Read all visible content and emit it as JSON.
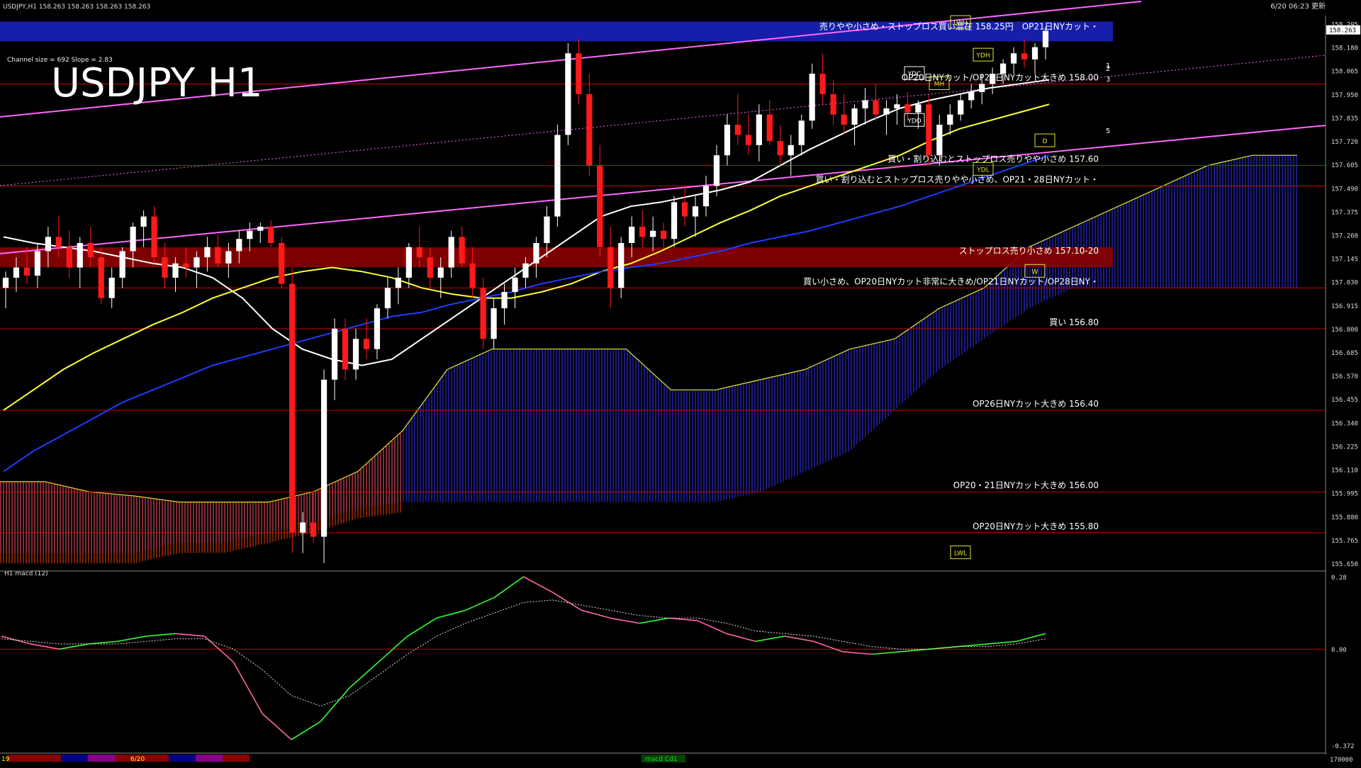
{
  "header": {
    "symbol_info": "USDJPY,H1  158.263 158.263 158.263 158.263",
    "datetime": "6/20 06:23 更新",
    "big_title": "USDJPY H1",
    "channel_info": "Channel size = 692 Slope = 2.83"
  },
  "colors": {
    "background": "#000000",
    "bull_candle": "#ffffff",
    "bear_candle": "#ff1a1a",
    "ema_fast": "#ffffff",
    "ema_slow": "#ffff33",
    "ema_long": "#1f3cff",
    "bollinger": "#cc0000",
    "chikou": "#33cc33",
    "channel": "#ff66ff",
    "kumo_bull": "#2a2ae0",
    "kumo_bear": "#ff4400",
    "level_line": "#cc0000",
    "macd_up": "#33ff33",
    "macd_down": "#ff66aa"
  },
  "chart_data": {
    "type": "candlestick",
    "title": "USDJPY H1",
    "ylim": [
      155.65,
      158.335
    ],
    "y_ticks": [
      "158.295",
      "158.180",
      "158.065",
      "157.950",
      "157.835",
      "157.720",
      "157.605",
      "157.490",
      "157.375",
      "157.260",
      "157.145",
      "157.030",
      "156.915",
      "156.800",
      "156.685",
      "156.570",
      "156.455",
      "156.340",
      "156.225",
      "156.110",
      "155.995",
      "155.880",
      "155.765",
      "155.650"
    ],
    "current_price": "158.263",
    "candles_ohlc": [
      [
        157.0,
        157.08,
        156.9,
        157.05
      ],
      [
        157.05,
        157.15,
        156.98,
        157.1
      ],
      [
        157.1,
        157.2,
        157.02,
        157.06
      ],
      [
        157.06,
        157.22,
        157.0,
        157.18
      ],
      [
        157.18,
        157.3,
        157.1,
        157.25
      ],
      [
        157.25,
        157.35,
        157.15,
        157.2
      ],
      [
        157.2,
        157.28,
        157.05,
        157.1
      ],
      [
        157.1,
        157.25,
        157.0,
        157.22
      ],
      [
        157.22,
        157.3,
        157.1,
        157.15
      ],
      [
        157.15,
        157.2,
        156.92,
        156.95
      ],
      [
        156.95,
        157.1,
        156.9,
        157.05
      ],
      [
        157.05,
        157.2,
        157.0,
        157.18
      ],
      [
        157.18,
        157.32,
        157.1,
        157.3
      ],
      [
        157.3,
        157.38,
        157.2,
        157.35
      ],
      [
        157.35,
        157.4,
        157.12,
        157.15
      ],
      [
        157.15,
        157.22,
        157.0,
        157.05
      ],
      [
        157.05,
        157.15,
        156.98,
        157.12
      ],
      [
        157.12,
        157.2,
        157.05,
        157.1
      ],
      [
        157.1,
        157.18,
        157.0,
        157.15
      ],
      [
        157.15,
        157.25,
        157.08,
        157.2
      ],
      [
        157.2,
        157.26,
        157.1,
        157.12
      ],
      [
        157.12,
        157.22,
        157.05,
        157.18
      ],
      [
        157.18,
        157.28,
        157.12,
        157.24
      ],
      [
        157.24,
        157.32,
        157.18,
        157.28
      ],
      [
        157.28,
        157.32,
        157.22,
        157.3
      ],
      [
        157.3,
        157.33,
        157.2,
        157.22
      ],
      [
        157.22,
        157.25,
        157.0,
        157.02
      ],
      [
        157.02,
        157.1,
        155.7,
        155.8
      ],
      [
        155.8,
        155.9,
        155.7,
        155.85
      ],
      [
        155.85,
        156.0,
        155.75,
        155.78
      ],
      [
        155.78,
        156.6,
        155.65,
        156.55
      ],
      [
        156.55,
        156.85,
        156.45,
        156.8
      ],
      [
        156.8,
        156.85,
        156.55,
        156.6
      ],
      [
        156.6,
        156.8,
        156.55,
        156.75
      ],
      [
        156.75,
        156.85,
        156.65,
        156.7
      ],
      [
        156.7,
        156.92,
        156.65,
        156.9
      ],
      [
        156.9,
        157.05,
        156.85,
        157.0
      ],
      [
        157.0,
        157.1,
        156.92,
        157.05
      ],
      [
        157.05,
        157.22,
        157.0,
        157.2
      ],
      [
        157.2,
        157.3,
        157.1,
        157.15
      ],
      [
        157.15,
        157.2,
        157.0,
        157.05
      ],
      [
        157.05,
        157.15,
        156.95,
        157.1
      ],
      [
        157.1,
        157.28,
        157.05,
        157.25
      ],
      [
        157.25,
        157.3,
        157.1,
        157.12
      ],
      [
        157.12,
        157.2,
        156.95,
        157.0
      ],
      [
        157.0,
        157.05,
        156.7,
        156.75
      ],
      [
        156.75,
        156.95,
        156.7,
        156.9
      ],
      [
        156.9,
        157.02,
        156.82,
        156.98
      ],
      [
        156.98,
        157.1,
        156.9,
        157.05
      ],
      [
        157.05,
        157.15,
        157.0,
        157.12
      ],
      [
        157.12,
        157.25,
        157.05,
        157.22
      ],
      [
        157.22,
        157.4,
        157.15,
        157.35
      ],
      [
        157.35,
        157.8,
        157.3,
        157.75
      ],
      [
        157.75,
        158.2,
        157.7,
        158.15
      ],
      [
        158.15,
        158.22,
        157.9,
        157.95
      ],
      [
        157.95,
        158.05,
        157.55,
        157.6
      ],
      [
        157.6,
        157.7,
        157.15,
        157.2
      ],
      [
        157.2,
        157.3,
        156.9,
        157.0
      ],
      [
        157.0,
        157.25,
        156.95,
        157.22
      ],
      [
        157.22,
        157.35,
        157.15,
        157.3
      ],
      [
        157.3,
        157.38,
        157.2,
        157.25
      ],
      [
        157.25,
        157.35,
        157.18,
        157.28
      ],
      [
        157.28,
        157.32,
        157.2,
        157.24
      ],
      [
        157.24,
        157.45,
        157.2,
        157.42
      ],
      [
        157.42,
        157.5,
        157.3,
        157.35
      ],
      [
        157.35,
        157.45,
        157.25,
        157.4
      ],
      [
        157.4,
        157.55,
        157.35,
        157.5
      ],
      [
        157.5,
        157.7,
        157.45,
        157.65
      ],
      [
        157.65,
        157.85,
        157.6,
        157.8
      ],
      [
        157.8,
        157.95,
        157.7,
        157.75
      ],
      [
        157.75,
        157.85,
        157.65,
        157.7
      ],
      [
        157.7,
        157.9,
        157.62,
        157.85
      ],
      [
        157.85,
        157.92,
        157.7,
        157.72
      ],
      [
        157.72,
        157.8,
        157.6,
        157.65
      ],
      [
        157.65,
        157.75,
        157.55,
        157.7
      ],
      [
        157.7,
        157.85,
        157.65,
        157.82
      ],
      [
        157.82,
        158.1,
        157.78,
        158.05
      ],
      [
        158.05,
        158.15,
        157.9,
        157.95
      ],
      [
        157.95,
        158.02,
        157.8,
        157.85
      ],
      [
        157.85,
        157.95,
        157.75,
        157.8
      ],
      [
        157.8,
        157.9,
        157.7,
        157.88
      ],
      [
        157.88,
        157.98,
        157.8,
        157.92
      ],
      [
        157.92,
        158.0,
        157.82,
        157.85
      ],
      [
        157.85,
        157.92,
        157.75,
        157.88
      ],
      [
        157.88,
        157.95,
        157.8,
        157.9
      ],
      [
        157.9,
        157.96,
        157.82,
        157.86
      ],
      [
        157.86,
        157.92,
        157.78,
        157.9
      ],
      [
        157.9,
        157.95,
        157.6,
        157.65
      ],
      [
        157.65,
        157.85,
        157.6,
        157.8
      ],
      [
        157.8,
        157.9,
        157.75,
        157.85
      ],
      [
        157.85,
        157.95,
        157.82,
        157.92
      ],
      [
        157.92,
        158.0,
        157.88,
        157.96
      ],
      [
        157.96,
        158.05,
        157.9,
        158.0
      ],
      [
        158.0,
        158.08,
        157.95,
        158.05
      ],
      [
        158.05,
        158.12,
        158.0,
        158.1
      ],
      [
        158.1,
        158.18,
        158.05,
        158.15
      ],
      [
        158.15,
        158.22,
        158.08,
        158.12
      ],
      [
        158.12,
        158.2,
        158.05,
        158.18
      ],
      [
        158.18,
        158.28,
        158.12,
        158.26
      ]
    ],
    "series": [
      {
        "name": "",
        "values": [
          157.25,
          157.22,
          157.2,
          157.18,
          157.15,
          157.12,
          157.1,
          157.05,
          156.95,
          156.8,
          156.7,
          156.65,
          156.62,
          156.65,
          156.75,
          156.85,
          156.95,
          157.05,
          157.15,
          157.25,
          157.35,
          157.4,
          157.42,
          157.45,
          157.48,
          157.52,
          157.6,
          157.68,
          157.75,
          157.82,
          157.88,
          157.92,
          157.95,
          157.98,
          158.0,
          158.02
        ]
      },
      {
        "name": "",
        "values": [
          156.4,
          156.5,
          156.6,
          156.68,
          156.75,
          156.82,
          156.88,
          156.95,
          157.0,
          157.05,
          157.08,
          157.1,
          157.08,
          157.05,
          157.0,
          156.97,
          156.95,
          156.95,
          156.98,
          157.02,
          157.08,
          157.12,
          157.18,
          157.25,
          157.32,
          157.38,
          157.45,
          157.5,
          157.55,
          157.6,
          157.65,
          157.72,
          157.78,
          157.82,
          157.86,
          157.9
        ]
      },
      {
        "name": "",
        "values": [
          156.1,
          156.2,
          156.28,
          156.36,
          156.44,
          156.5,
          156.56,
          156.62,
          156.66,
          156.7,
          156.74,
          156.78,
          156.82,
          156.86,
          156.88,
          156.92,
          156.95,
          156.98,
          157.02,
          157.05,
          157.08,
          157.1,
          157.12,
          157.15,
          157.18,
          157.22,
          157.25,
          157.28,
          157.32,
          157.36,
          157.4,
          157.45,
          157.5,
          157.55,
          157.6,
          157.65
        ]
      }
    ],
    "kumo_upper": [
      156.05,
      156.05,
      156.0,
      155.98,
      155.95,
      155.95,
      155.95,
      156.0,
      156.1,
      156.3,
      156.6,
      156.7,
      156.7,
      156.7,
      156.7,
      156.5,
      156.5,
      156.55,
      156.6,
      156.7,
      156.75,
      156.9,
      157.0,
      157.2,
      157.3,
      157.4,
      157.5,
      157.6,
      157.65,
      157.65
    ],
    "kumo_lower": [
      155.7,
      155.7,
      155.7,
      155.7,
      155.75,
      155.75,
      155.8,
      155.85,
      155.92,
      155.95,
      155.95,
      155.95,
      155.95,
      155.95,
      155.95,
      155.95,
      155.95,
      156.0,
      156.1,
      156.2,
      156.4,
      156.6,
      156.75,
      156.9,
      157.0,
      157.0,
      157.0,
      157.0,
      157.0,
      157.0
    ],
    "macd": [
      0.05,
      0.02,
      0.0,
      0.02,
      0.03,
      0.05,
      0.06,
      0.05,
      -0.05,
      -0.25,
      -0.35,
      -0.28,
      -0.15,
      -0.05,
      0.05,
      0.12,
      0.15,
      0.2,
      0.28,
      0.22,
      0.15,
      0.12,
      0.1,
      0.12,
      0.11,
      0.06,
      0.03,
      0.05,
      0.03,
      -0.01,
      -0.02,
      -0.01,
      0.0,
      0.01,
      0.02,
      0.03,
      0.06
    ],
    "macd_signal": [
      0.04,
      0.03,
      0.02,
      0.02,
      0.02,
      0.03,
      0.04,
      0.04,
      0.0,
      -0.08,
      -0.18,
      -0.22,
      -0.18,
      -0.1,
      -0.02,
      0.05,
      0.1,
      0.14,
      0.18,
      0.19,
      0.17,
      0.15,
      0.13,
      0.12,
      0.12,
      0.1,
      0.07,
      0.06,
      0.05,
      0.03,
      0.01,
      0.0,
      0.0,
      0.01,
      0.01,
      0.02,
      0.04
    ],
    "macd_label": "H1  macd (12)",
    "macd_ticks": [
      "0.28",
      "0.00",
      "-0.372"
    ],
    "levels": [
      {
        "price": 158.25,
        "text": "売りやや小さめ・ストップロス買い混在 158.25円　OP21日NYカット・",
        "kind": "band_blue"
      },
      {
        "price": 158.0,
        "text": "OP20日NYカット/OP28日NYカット大きめ 158.00",
        "kind": "line"
      },
      {
        "price": 157.6,
        "text": "買い・割り込むとストップロス売りやや小さめ 157.60",
        "kind": "line"
      },
      {
        "price": 157.5,
        "text": "買い・割り込むとストップロス売りやや小さめ、OP21・28日NYカット・",
        "kind": "line"
      },
      {
        "price": 157.15,
        "text": "ストップロス売り小さめ 157.10-20",
        "kind": "band_red"
      },
      {
        "price": 157.0,
        "text": "買い小さめ、OP20日NYカット非常に大きめ/OP21日NYカット/OP28日NY・",
        "kind": "line"
      },
      {
        "price": 156.8,
        "text": "買い 156.80",
        "kind": "line"
      },
      {
        "price": 156.4,
        "text": "OP26日NYカット大きめ 156.40",
        "kind": "line"
      },
      {
        "price": 156.0,
        "text": "OP20・21日NYカット大きめ 156.00",
        "kind": "line"
      },
      {
        "price": 155.8,
        "text": "OP20日NYカット大きめ 155.80",
        "kind": "line"
      }
    ],
    "markers": [
      {
        "label": "YDC",
        "price": 158.05
      },
      {
        "label": "YDH",
        "price": 158.14
      },
      {
        "label": "YDO",
        "price": 157.82
      },
      {
        "label": "YDL",
        "price": 157.58
      },
      {
        "label": "LWH",
        "price": 158.3
      },
      {
        "label": "LWL",
        "price": 155.7
      },
      {
        "label": "MH",
        "price": 158.0
      },
      {
        "label": "W",
        "price": 157.08
      },
      {
        "label": "D",
        "price": 157.72
      }
    ],
    "channel_numbers": [
      "1",
      "2",
      "3",
      "5"
    ]
  },
  "footer": {
    "time_labels": [
      "19",
      "6/20"
    ],
    "indicator_tag": "macd Cd1",
    "bottom_axis_value": "170000"
  }
}
